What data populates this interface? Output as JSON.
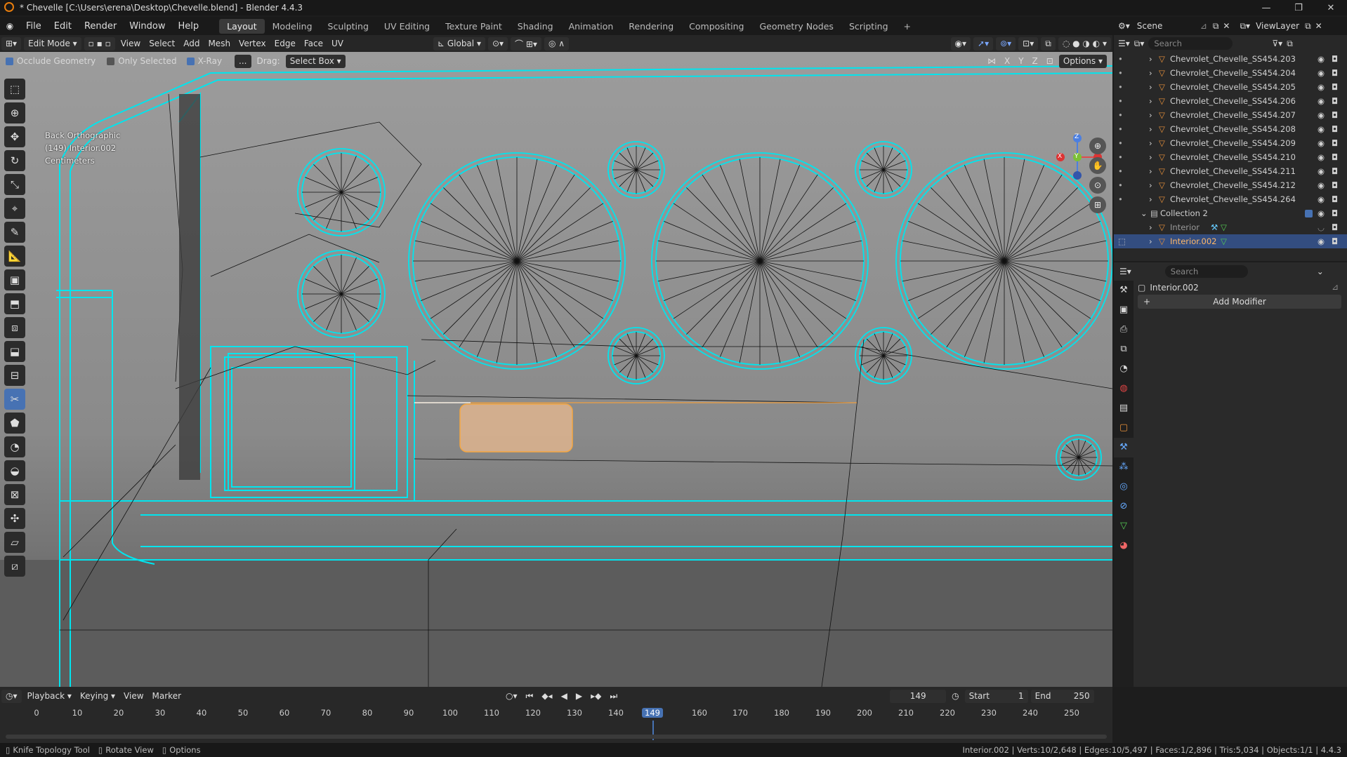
{
  "window": {
    "title": "* Chevelle [C:\\Users\\erena\\Desktop\\Chevelle.blend] - Blender 4.4.3"
  },
  "menu": [
    "File",
    "Edit",
    "Render",
    "Window",
    "Help"
  ],
  "workspaces": [
    "Layout",
    "Modeling",
    "Sculpting",
    "UV Editing",
    "Texture Paint",
    "Shading",
    "Animation",
    "Rendering",
    "Compositing",
    "Geometry Nodes",
    "Scripting"
  ],
  "active_workspace": "Layout",
  "scene": {
    "name": "Scene",
    "view_layer": "ViewLayer"
  },
  "header": {
    "mode": "Edit Mode",
    "menus": [
      "View",
      "Select",
      "Add",
      "Mesh",
      "Vertex",
      "Edge",
      "Face",
      "UV"
    ],
    "orientation": "Global"
  },
  "options_bar": {
    "occlude": "Occlude Geometry",
    "only_selected": "Only Selected",
    "xray": "X-Ray",
    "dots": "...",
    "drag_label": "Drag:",
    "drag_value": "Select Box",
    "axes": [
      "X",
      "Y",
      "Z"
    ],
    "options": "Options"
  },
  "viewport": {
    "view_name": "Back Orthographic",
    "object": "(149) Interior.002",
    "units": "Centimeters"
  },
  "gizmo": {
    "x": "X",
    "y": "Y",
    "z": "Z"
  },
  "outliner": {
    "search": "Search",
    "items": [
      "Chevrolet_Chevelle_SS454.203",
      "Chevrolet_Chevelle_SS454.204",
      "Chevrolet_Chevelle_SS454.205",
      "Chevrolet_Chevelle_SS454.206",
      "Chevrolet_Chevelle_SS454.207",
      "Chevrolet_Chevelle_SS454.208",
      "Chevrolet_Chevelle_SS454.209",
      "Chevrolet_Chevelle_SS454.210",
      "Chevrolet_Chevelle_SS454.211",
      "Chevrolet_Chevelle_SS454.212",
      "Chevrolet_Chevelle_SS454.264"
    ],
    "collection": "Collection 2",
    "interior": "Interior",
    "selected": "Interior.002"
  },
  "properties": {
    "search": "Search",
    "object": "Interior.002",
    "add_modifier": "Add Modifier"
  },
  "timeline": {
    "menus": [
      "Playback",
      "Keying",
      "View",
      "Marker"
    ],
    "current": "149",
    "start_label": "Start",
    "start": "1",
    "end_label": "End",
    "end": "250",
    "ticks": [
      "0",
      "10",
      "20",
      "30",
      "40",
      "50",
      "60",
      "70",
      "80",
      "90",
      "100",
      "110",
      "120",
      "130",
      "140",
      "149",
      "160",
      "170",
      "180",
      "190",
      "200",
      "210",
      "220",
      "230",
      "240",
      "250"
    ]
  },
  "status": {
    "tool": "Knife Topology Tool",
    "rotate": "Rotate View",
    "options": "Options",
    "stats": "Interior.002 | Verts:10/2,648 | Edges:10/5,497 | Faces:1/2,896 | Tris:5,034 | Objects:1/1 | 4.4.3"
  },
  "colors": {
    "accent": "#4772b3",
    "wire": "#00e5ee",
    "selected_face": "#f5a742"
  }
}
